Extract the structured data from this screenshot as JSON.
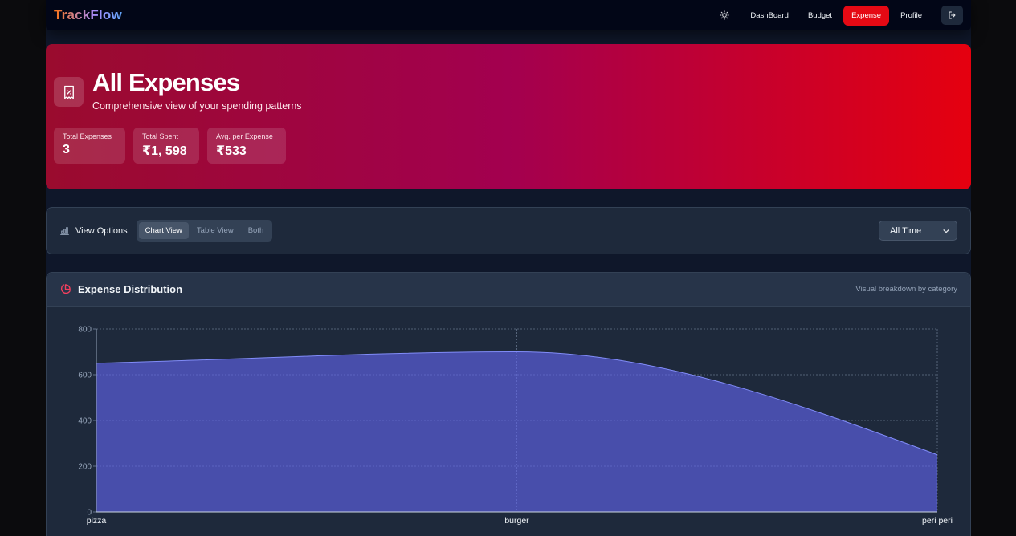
{
  "nav": {
    "brand": "TrackFlow",
    "links": [
      "DashBoard",
      "Budget",
      "Expense",
      "Profile"
    ],
    "active": "Expense"
  },
  "hero": {
    "title": "All Expenses",
    "subtitle": "Comprehensive view of your spending patterns",
    "stats": [
      {
        "label": "Total Expenses",
        "value": "3"
      },
      {
        "label": "Total Spent",
        "value": "₹1, 598"
      },
      {
        "label": "Avg. per Expense",
        "value": "₹533"
      }
    ]
  },
  "options": {
    "title": "View Options",
    "tabs": [
      "Chart View",
      "Table View",
      "Both"
    ],
    "active_tab": "Chart View",
    "time_filter": "All Time"
  },
  "card": {
    "title": "Expense Distribution",
    "note": "Visual breakdown by category"
  },
  "chart_data": {
    "type": "area",
    "categories": [
      "pizza",
      "burger",
      "peri peri"
    ],
    "values": [
      650,
      700,
      250
    ],
    "ylim": [
      0,
      800
    ],
    "yticks": [
      "0",
      "200",
      "400",
      "600",
      "800"
    ],
    "grid": true,
    "fill_color": "#6366f1",
    "legend": "none"
  },
  "colors": {
    "accent": "#e50914",
    "hero_gradient": [
      "#9a0b2e",
      "#a3004f",
      "#e5000f"
    ],
    "background": "#0f172a"
  }
}
